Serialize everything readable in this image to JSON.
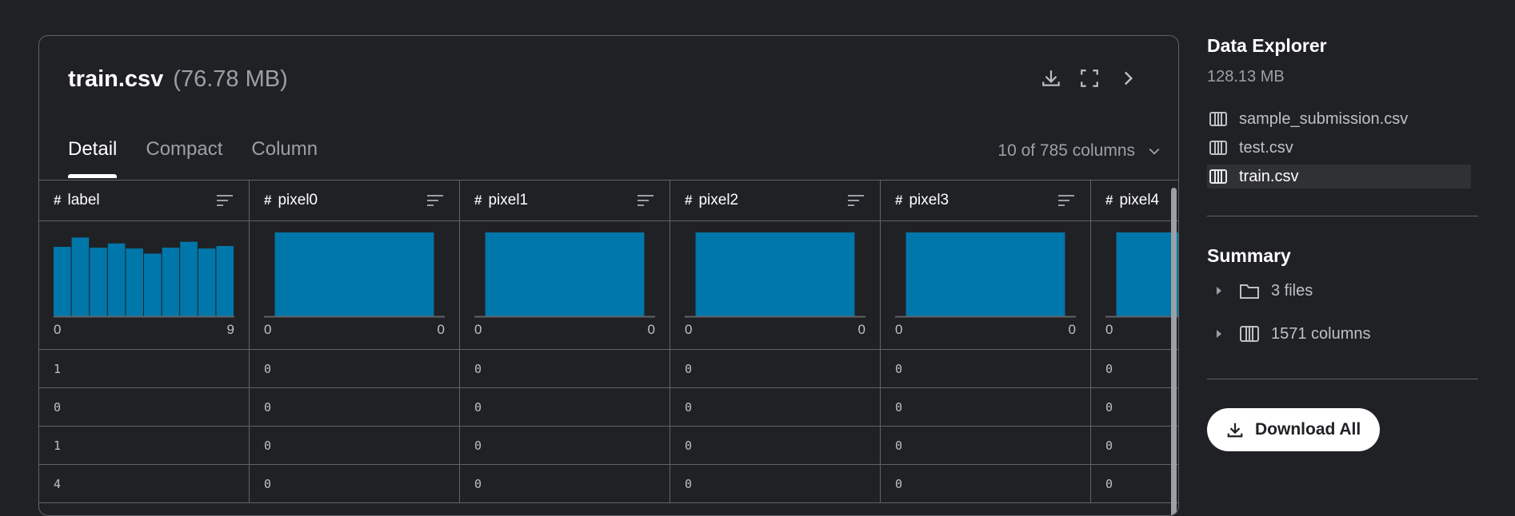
{
  "panel": {
    "file_name": "train.csv",
    "file_size": "(76.78 MB)",
    "tabs": [
      "Detail",
      "Compact",
      "Column"
    ],
    "active_tab": "Detail",
    "column_selector": "10 of 785 columns"
  },
  "columns": [
    {
      "name": "label",
      "min": "0",
      "max": "9",
      "hist": [
        0.83,
        0.94,
        0.82,
        0.87,
        0.81,
        0.75,
        0.82,
        0.89,
        0.81,
        0.84
      ],
      "cells": [
        "1",
        "0",
        "1",
        "4"
      ]
    },
    {
      "name": "pixel0",
      "min": "0",
      "max": "0",
      "hist": [
        1.0
      ],
      "cells": [
        "0",
        "0",
        "0",
        "0"
      ]
    },
    {
      "name": "pixel1",
      "min": "0",
      "max": "0",
      "hist": [
        1.0
      ],
      "cells": [
        "0",
        "0",
        "0",
        "0"
      ]
    },
    {
      "name": "pixel2",
      "min": "0",
      "max": "0",
      "hist": [
        1.0
      ],
      "cells": [
        "0",
        "0",
        "0",
        "0"
      ]
    },
    {
      "name": "pixel3",
      "min": "0",
      "max": "0",
      "hist": [
        1.0
      ],
      "cells": [
        "0",
        "0",
        "0",
        "0"
      ]
    },
    {
      "name": "pixel4",
      "min": "0",
      "max": "",
      "hist": [
        1.0
      ],
      "cells": [
        "0",
        "0",
        "0",
        "0"
      ]
    }
  ],
  "sidebar": {
    "title": "Data Explorer",
    "size": "128.13 MB",
    "files": [
      "sample_submission.csv",
      "test.csv",
      "train.csv"
    ],
    "selected_file": "train.csv",
    "summary_title": "Summary",
    "summary": [
      {
        "label": "3 files",
        "icon": "folder-icon"
      },
      {
        "label": "1571 columns",
        "icon": "table-icon"
      }
    ],
    "download_all": "Download All"
  },
  "colors": {
    "background": "#202124",
    "histogram_bar": "#0077aa",
    "border": "#5f6368"
  }
}
